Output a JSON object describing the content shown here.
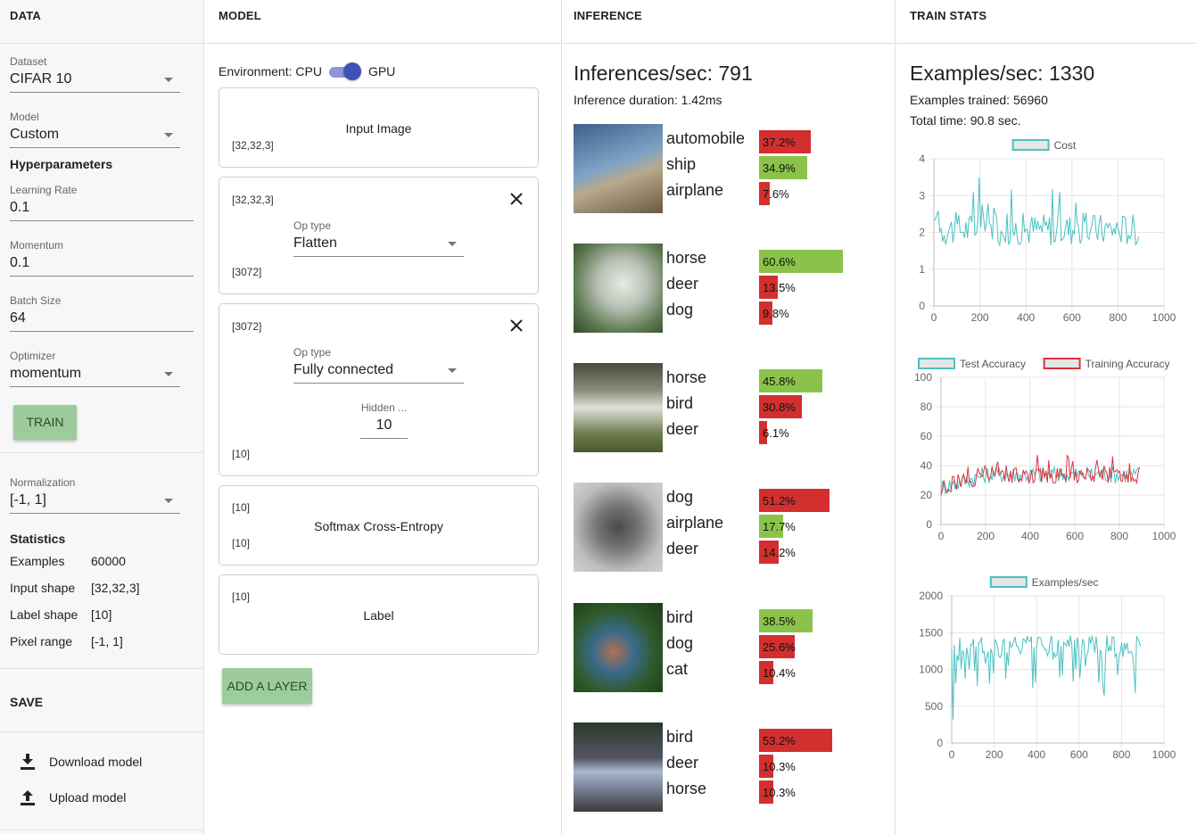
{
  "columns": {
    "data": "DATA",
    "model": "MODEL",
    "inference": "INFERENCE",
    "stats": "TRAIN STATS"
  },
  "data_panel": {
    "dataset_label": "Dataset",
    "dataset_value": "CIFAR 10",
    "model_label": "Model",
    "model_value": "Custom",
    "hyper_title": "Hyperparameters",
    "lr_label": "Learning Rate",
    "lr_value": "0.1",
    "momentum_label": "Momentum",
    "momentum_value": "0.1",
    "batch_label": "Batch Size",
    "batch_value": "64",
    "optimizer_label": "Optimizer",
    "optimizer_value": "momentum",
    "train_button": "TRAIN",
    "norm_label": "Normalization",
    "norm_value": "[-1, 1]",
    "stats_title": "Statistics",
    "stats": [
      {
        "k": "Examples",
        "v": "60000"
      },
      {
        "k": "Input shape",
        "v": "[32,32,3]"
      },
      {
        "k": "Label shape",
        "v": "[10]"
      },
      {
        "k": "Pixel range",
        "v": "[-1, 1]"
      }
    ],
    "save_title": "SAVE",
    "download": "Download model",
    "upload": "Upload model"
  },
  "model_panel": {
    "env_label": "Environment: CPU",
    "env_gpu": "GPU",
    "gpu_enabled": true,
    "input_title": "Input Image",
    "input_shape": "[32,32,3]",
    "flatten_in": "[32,32,3]",
    "flatten_op_label": "Op type",
    "flatten_op_value": "Flatten",
    "flatten_out": "[3072]",
    "fc_in": "[3072]",
    "fc_op_label": "Op type",
    "fc_op_value": "Fully connected",
    "fc_hidden_label": "Hidden ...",
    "fc_hidden_value": "10",
    "fc_out": "[10]",
    "softmax_in": "[10]",
    "softmax_title": "Softmax Cross-Entropy",
    "softmax_out": "[10]",
    "label_in": "[10]",
    "label_title": "Label",
    "add_layer": "ADD A LAYER"
  },
  "inference_panel": {
    "rate": "Inferences/sec: 791",
    "duration": "Inference duration: 1.42ms",
    "colors": {
      "correct": "#8bc34a",
      "wrong": "#d32f2f"
    },
    "samples": [
      {
        "preds": [
          {
            "c": "automobile",
            "p": "37.2%",
            "v": 0.372,
            "ok": false
          },
          {
            "c": "ship",
            "p": "34.9%",
            "v": 0.349,
            "ok": true
          },
          {
            "c": "airplane",
            "p": "7.6%",
            "v": 0.076,
            "ok": false
          }
        ]
      },
      {
        "preds": [
          {
            "c": "horse",
            "p": "60.6%",
            "v": 0.606,
            "ok": true
          },
          {
            "c": "deer",
            "p": "13.5%",
            "v": 0.135,
            "ok": false
          },
          {
            "c": "dog",
            "p": "9.8%",
            "v": 0.098,
            "ok": false
          }
        ]
      },
      {
        "preds": [
          {
            "c": "horse",
            "p": "45.8%",
            "v": 0.458,
            "ok": true
          },
          {
            "c": "bird",
            "p": "30.8%",
            "v": 0.308,
            "ok": false
          },
          {
            "c": "deer",
            "p": "6.1%",
            "v": 0.061,
            "ok": false
          }
        ]
      },
      {
        "preds": [
          {
            "c": "dog",
            "p": "51.2%",
            "v": 0.512,
            "ok": false
          },
          {
            "c": "airplane",
            "p": "17.7%",
            "v": 0.177,
            "ok": true
          },
          {
            "c": "deer",
            "p": "14.2%",
            "v": 0.142,
            "ok": false
          }
        ]
      },
      {
        "preds": [
          {
            "c": "bird",
            "p": "38.5%",
            "v": 0.385,
            "ok": true
          },
          {
            "c": "dog",
            "p": "25.6%",
            "v": 0.256,
            "ok": false
          },
          {
            "c": "cat",
            "p": "10.4%",
            "v": 0.104,
            "ok": false
          }
        ]
      },
      {
        "preds": [
          {
            "c": "bird",
            "p": "53.2%",
            "v": 0.532,
            "ok": false
          },
          {
            "c": "deer",
            "p": "10.3%",
            "v": 0.103,
            "ok": false
          },
          {
            "c": "horse",
            "p": "10.3%",
            "v": 0.103,
            "ok": false
          }
        ]
      }
    ]
  },
  "stats_panel": {
    "rate": "Examples/sec: 1330",
    "trained": "Examples trained: 56960",
    "total_time": "Total time: 90.8 sec."
  },
  "chart_data": [
    {
      "type": "line",
      "series": [
        {
          "name": "Cost",
          "color": "#4bc0c0"
        }
      ],
      "xlim": [
        0,
        1000
      ],
      "ylim": [
        0,
        4
      ],
      "xticks": [
        0,
        200,
        400,
        600,
        800,
        1000
      ],
      "yticks": [
        0,
        1,
        2,
        3,
        4
      ],
      "n_points": 890,
      "y_range_approx": [
        1.5,
        3.4
      ],
      "y_mean_approx": 2.1,
      "legend": "top-center",
      "grid": true
    },
    {
      "type": "line",
      "series": [
        {
          "name": "Test Accuracy",
          "color": "#4bc0c0"
        },
        {
          "name": "Training Accuracy",
          "color": "#e0303a"
        }
      ],
      "xlim": [
        0,
        1000
      ],
      "ylim": [
        0,
        100
      ],
      "xticks": [
        0,
        200,
        400,
        600,
        800,
        1000
      ],
      "yticks": [
        0,
        20,
        40,
        60,
        80,
        100
      ],
      "n_points": 890,
      "y_range_approx": [
        15,
        46
      ],
      "y_mean_approx": 33,
      "legend": "top-center",
      "grid": true
    },
    {
      "type": "line",
      "series": [
        {
          "name": "Examples/sec",
          "color": "#4bc0c0"
        }
      ],
      "xlim": [
        0,
        1000
      ],
      "ylim": [
        0,
        2000
      ],
      "xticks": [
        0,
        200,
        400,
        600,
        800,
        1000
      ],
      "yticks": [
        0,
        500,
        1000,
        1500,
        2000
      ],
      "n_points": 890,
      "y_range_approx": [
        300,
        1600
      ],
      "y_mean_approx": 1250,
      "legend": "top-center",
      "grid": true
    }
  ]
}
